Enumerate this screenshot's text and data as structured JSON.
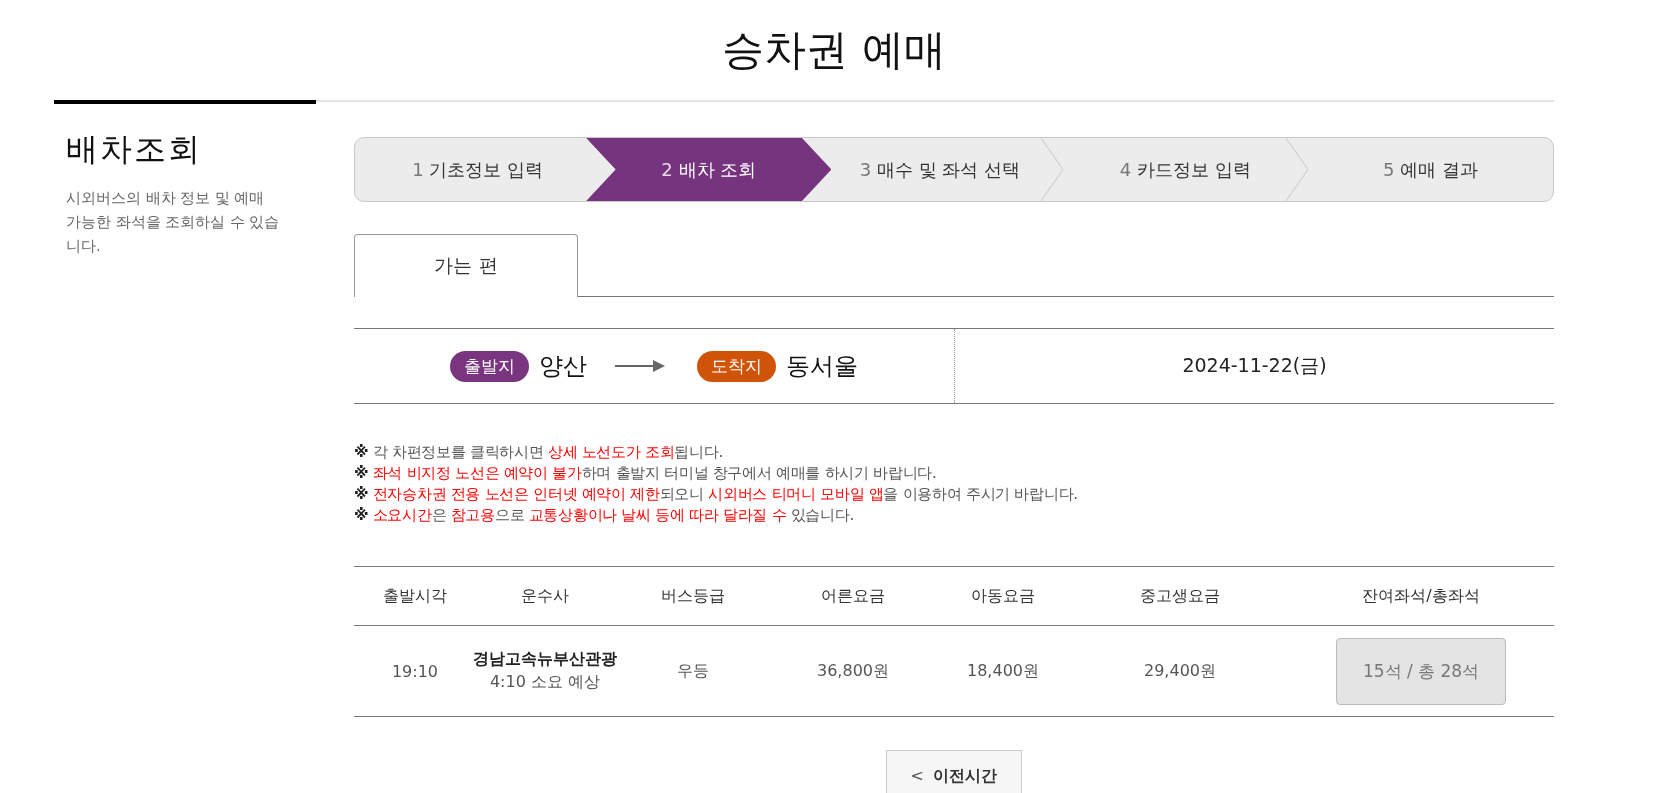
{
  "page_title": "승차권 예매",
  "sidebar": {
    "title": "배차조회",
    "description": "시외버스의 배차 정보 및 예매 가능한 좌석을 조회하실 수 있습니다."
  },
  "steps": [
    {
      "number": "1",
      "label": "기초정보 입력",
      "selected": false
    },
    {
      "number": "2",
      "label": "배차 조회",
      "selected": true
    },
    {
      "number": "3",
      "label": "매수 및 좌석 선택",
      "selected": false
    },
    {
      "number": "4",
      "label": "카드정보 입력",
      "selected": false
    },
    {
      "number": "5",
      "label": "예매 결과",
      "selected": false
    }
  ],
  "tabs": [
    {
      "label": "가는 편",
      "selected": true
    }
  ],
  "route": {
    "origin_label": "출발지",
    "origin": "양산",
    "destination_label": "도착지",
    "destination": "동서울",
    "date": "2024-11-22(금)"
  },
  "notices": [
    {
      "mark": "※",
      "segments": [
        {
          "text": "각 차편정보를 클릭하시면 ",
          "highlight": false
        },
        {
          "text": "상세 노선도가 조회",
          "highlight": true
        },
        {
          "text": "됩니다.",
          "highlight": false
        }
      ]
    },
    {
      "mark": "※",
      "segments": [
        {
          "text": "좌석 비지정 노선은 예약이 불가",
          "highlight": true
        },
        {
          "text": "하며 출발지 터미널 창구에서 예매를 하시기 바랍니다.",
          "highlight": false
        }
      ]
    },
    {
      "mark": "※",
      "segments": [
        {
          "text": "전자승차권 전용 노선은 인터넷 예약이 제한",
          "highlight": true
        },
        {
          "text": "되오니 ",
          "highlight": false
        },
        {
          "text": "시외버스 티머니 모바일 앱",
          "highlight": true
        },
        {
          "text": "을 이용하여 주시기 바랍니다.",
          "highlight": false
        }
      ]
    },
    {
      "mark": "※",
      "segments": [
        {
          "text": "소요시간",
          "highlight": true
        },
        {
          "text": "은 ",
          "highlight": false
        },
        {
          "text": "참고용",
          "highlight": true
        },
        {
          "text": "으로 ",
          "highlight": false
        },
        {
          "text": "교통상황이나 날씨 등에 따라 달라질 수",
          "highlight": true
        },
        {
          "text": " 있습니다.",
          "highlight": false
        }
      ]
    }
  ],
  "table": {
    "columns": [
      "출발시각",
      "운수사",
      "버스등급",
      "어른요금",
      "아동요금",
      "중고생요금",
      "잔여좌석/총좌석"
    ],
    "rows": [
      {
        "departure": "19:10",
        "company": "경남고속뉴부산관광",
        "duration": "4:10 소요 예상",
        "grade": "우등",
        "adult_fare": "36,800원",
        "child_fare": "18,400원",
        "student_fare": "29,400원",
        "seats": "15석 / 총 28석"
      }
    ]
  },
  "prev_button": {
    "icon": "<",
    "label": "이전시간"
  }
}
